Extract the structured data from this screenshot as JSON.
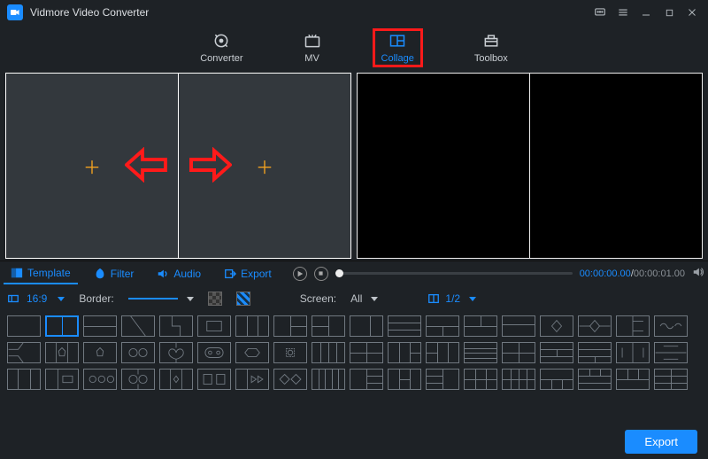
{
  "app": {
    "title": "Vidmore Video Converter"
  },
  "nav": {
    "converter": "Converter",
    "mv": "MV",
    "collage": "Collage",
    "toolbox": "Toolbox"
  },
  "tabs": {
    "template": "Template",
    "filter": "Filter",
    "audio": "Audio",
    "export": "Export"
  },
  "player": {
    "current": "00:00:00.00",
    "total": "00:00:01.00"
  },
  "options": {
    "aspect": "16:9",
    "border_label": "Border:",
    "screen_label": "Screen:",
    "screen_value": "All",
    "layout_value": "1/2"
  },
  "footer": {
    "export": "Export"
  },
  "colors": {
    "accent": "#1a8cff",
    "highlight": "#ff1a1a",
    "add": "#f0a020"
  }
}
